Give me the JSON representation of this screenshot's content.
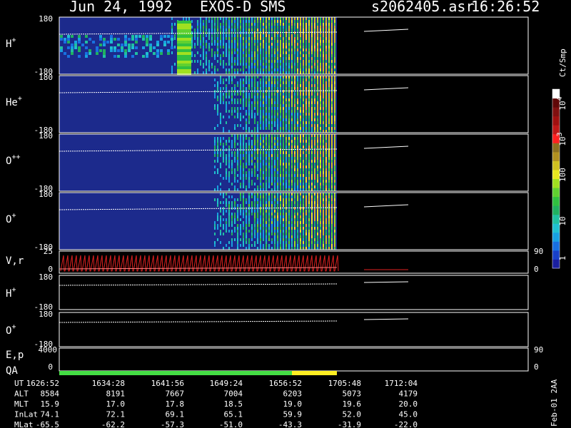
{
  "header": {
    "date": "Jun 24, 1992",
    "instrument": "EXOS-D SMS",
    "file": "s2062405.asr",
    "time": "16:26:52"
  },
  "colorbar": {
    "unit_label": "Ct/Smp",
    "tick_labels": [
      "1",
      "10",
      "100",
      "10",
      "10"
    ],
    "tick_exponents": [
      "",
      "",
      "",
      "3",
      "4"
    ],
    "palette": [
      "#1a1fa0",
      "#1840c8",
      "#1870e0",
      "#18a0e0",
      "#20c0d0",
      "#20c0a0",
      "#20b060",
      "#30c040",
      "#60d030",
      "#a0e020",
      "#e8e820",
      "#d0c020",
      "#b09020",
      "#8c7020",
      "#ff2020",
      "#c01818",
      "#a01010",
      "#801010",
      "#600808",
      "#ffffff"
    ]
  },
  "right_axis_labels": {
    "vr_top": "90",
    "vr_bottom": "0",
    "ep_top": "90",
    "ep_bottom": "0"
  },
  "panels": [
    {
      "key": "h",
      "label": "H",
      "sup": "+",
      "top": "180",
      "bottom": "-180"
    },
    {
      "key": "he",
      "label": "He",
      "sup": "+",
      "top": "180",
      "bottom": "-180"
    },
    {
      "key": "opp",
      "label": "O",
      "sup": "++",
      "top": "180",
      "bottom": "-180"
    },
    {
      "key": "op",
      "label": "O",
      "sup": "+",
      "top": "180",
      "bottom": "-180"
    }
  ],
  "vr_panel": {
    "label": "V,r",
    "top": "25",
    "bottom": "0"
  },
  "line_panels": [
    {
      "key": "h2",
      "label": "H",
      "sup": "+",
      "top": "180",
      "bottom": "-180"
    },
    {
      "key": "o2",
      "label": "O",
      "sup": "+",
      "top": "180",
      "bottom": "-180"
    }
  ],
  "ep_panel": {
    "label1": "E,p",
    "label2": "QA",
    "top": "4000",
    "bottom": "0"
  },
  "qa_bar": {
    "colors": [
      "#44dd44",
      "#ffee22"
    ],
    "split_time": "1656:52"
  },
  "ephemeris": {
    "row_labels": [
      "UT",
      "ALT",
      "MLT",
      "InLat",
      "MLat"
    ],
    "columns": [
      {
        "UT": "1626:52",
        "ALT": "8584",
        "MLT": "15.9",
        "InLat": "74.1",
        "MLat": "-65.5"
      },
      {
        "UT": "1634:28",
        "ALT": "8191",
        "MLT": "17.0",
        "InLat": "72.1",
        "MLat": "-62.2"
      },
      {
        "UT": "1641:56",
        "ALT": "7667",
        "MLT": "17.8",
        "InLat": "69.1",
        "MLat": "-57.3"
      },
      {
        "UT": "1649:24",
        "ALT": "7004",
        "MLT": "18.5",
        "InLat": "65.1",
        "MLat": "-51.0"
      },
      {
        "UT": "1656:52",
        "ALT": "6203",
        "MLT": "19.0",
        "InLat": "59.9",
        "MLat": "-43.3"
      },
      {
        "UT": "1705:48",
        "ALT": "5073",
        "MLT": "19.6",
        "InLat": "52.0",
        "MLat": "-31.9"
      },
      {
        "UT": "1712:04",
        "ALT": "4179",
        "MLT": "20.0",
        "InLat": "45.0",
        "MLat": "-22.0"
      }
    ]
  },
  "side_note": "Feb-01 2AA",
  "chart_data": {
    "type": "heatmap",
    "title": "Jun 24, 1992   EXOS-D SMS",
    "x_axis": "UT",
    "x_ticks": [
      "1626:52",
      "1634:28",
      "1641:56",
      "1649:24",
      "1656:52",
      "1705:48",
      "1712:04"
    ],
    "data_end_time_approx": "1705:48",
    "panels": [
      "H+",
      "He+",
      "O++",
      "O+"
    ],
    "ylim": [
      -180,
      180
    ],
    "color_scale": "log",
    "color_range": [
      1,
      10000
    ],
    "color_unit": "Ct/Smp"
  }
}
